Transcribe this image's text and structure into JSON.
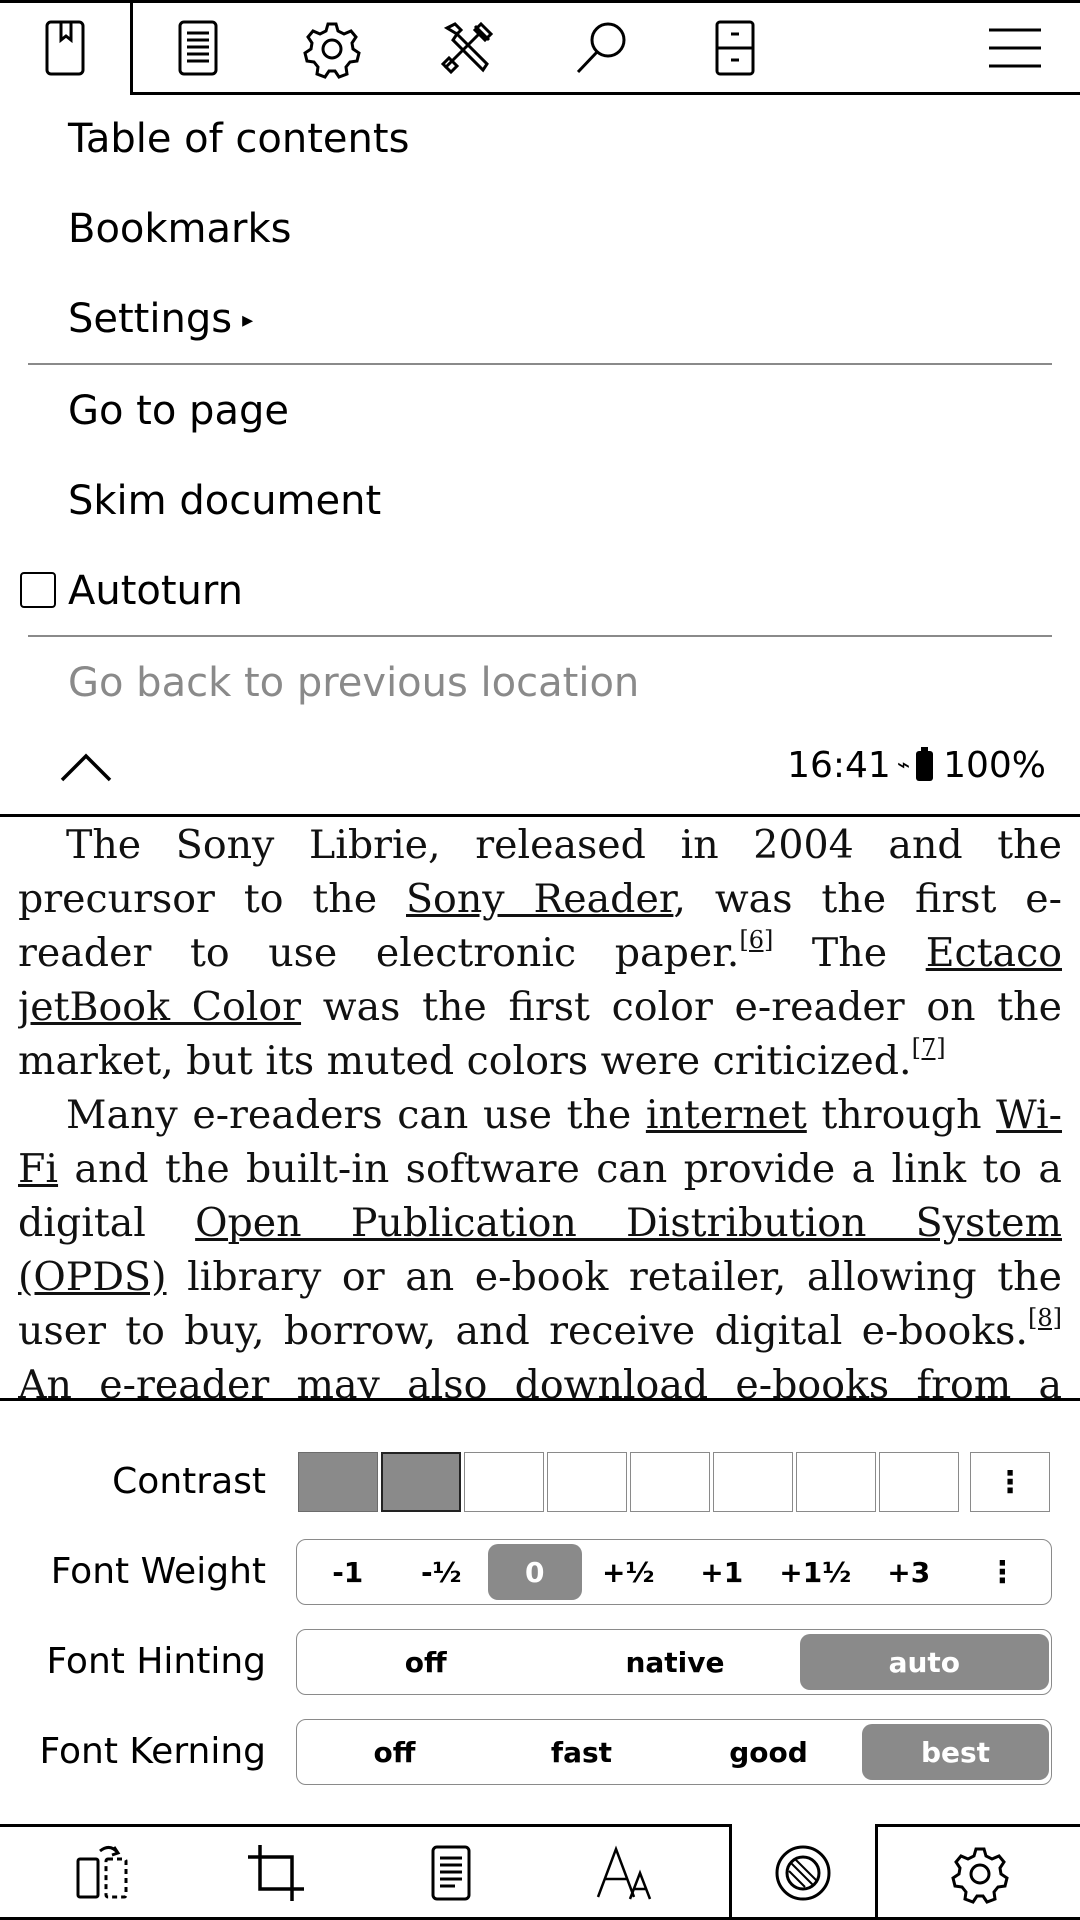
{
  "top_bar": {
    "icons": [
      "bookmark-icon",
      "document-icon",
      "gear-icon",
      "tools-icon",
      "search-icon",
      "filing-cabinet-icon",
      "hamburger-menu-icon"
    ]
  },
  "menu": {
    "items": [
      {
        "label": "Table of contents"
      },
      {
        "label": "Bookmarks"
      },
      {
        "label": "Settings",
        "submenu_arrow": "▸"
      },
      {
        "label": "Go to page"
      },
      {
        "label": "Skim document"
      },
      {
        "label": "Autoturn",
        "checked": false
      },
      {
        "label": "Go back to previous location",
        "disabled": true
      }
    ]
  },
  "status": {
    "time": "16:41",
    "wifi_glyph": "⌁",
    "battery": "100%"
  },
  "document": {
    "p1_a": "The Sony Librie, released in 2004 and the precursor to the ",
    "p1_link1": "Sony Reader",
    "p1_b": ", was the first e-reader to use elec­tronic paper.",
    "p1_ref1": "[6]",
    "p1_c": " The ",
    "p1_link2": "Ectaco jetBook Color",
    "p1_d": " was the first color e-reader on the market, but its muted colors were criticized.",
    "p1_ref2": "[7]",
    "p2_a": "Many e-readers can use the ",
    "p2_link1": "internet",
    "p2_b": " through ",
    "p2_link2": "Wi-Fi",
    "p2_c": " and the built-in software can provide a link to a digital ",
    "p2_link3": "Open Publication Distribution System (OPDS)",
    "p2_d": " library or an e-book retailer, allowing the user to buy, borrow, and receive digital e-books.",
    "p2_ref1": "[8]",
    "p2_e": " An e-reader may also down­load e-books from a computer or read them from a"
  },
  "settings": {
    "contrast": {
      "label": "Contrast",
      "levels": 8,
      "filled": 2,
      "more": "⋮"
    },
    "font_weight": {
      "label": "Font Weight",
      "options": [
        "-1",
        "-½",
        "0",
        "+½",
        "+1",
        "+1½",
        "+3"
      ],
      "selected": "0",
      "more": "⋮"
    },
    "font_hinting": {
      "label": "Font Hinting",
      "options": [
        "off",
        "native",
        "auto"
      ],
      "selected": "auto"
    },
    "font_kerning": {
      "label": "Font Kerning",
      "options": [
        "off",
        "fast",
        "good",
        "best"
      ],
      "selected": "best"
    }
  },
  "bottom_bar": {
    "icons": [
      "page-turn-icon",
      "crop-icon",
      "document-lines-icon",
      "font-size-icon",
      "contrast-icon",
      "gear-icon"
    ],
    "active": "contrast-icon"
  }
}
